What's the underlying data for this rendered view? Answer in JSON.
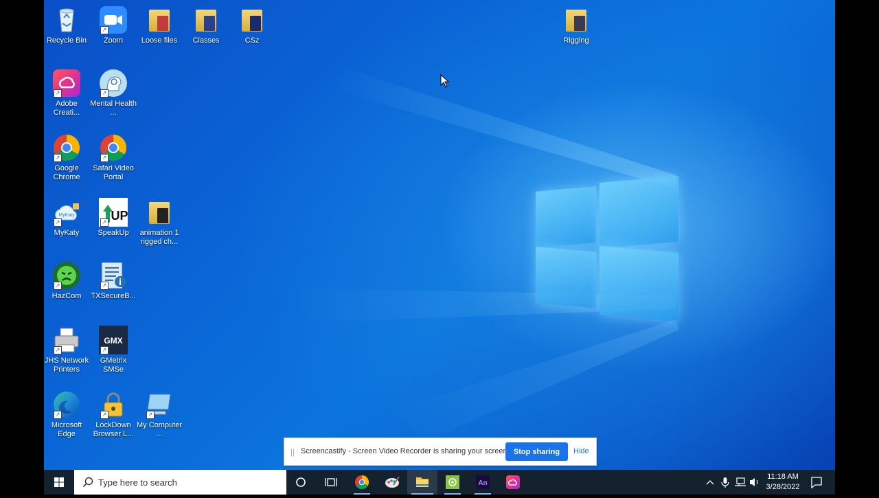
{
  "desktop": {
    "icons": [
      {
        "label": "Recycle Bin"
      },
      {
        "label": "Zoom"
      },
      {
        "label": "Loose files"
      },
      {
        "label": "Classes"
      },
      {
        "label": "CSz"
      },
      {
        "label": "Rigging"
      },
      {
        "label": "Adobe Creati..."
      },
      {
        "label": "Mental Health ..."
      },
      {
        "label": "Google Chrome"
      },
      {
        "label": "Safari Video Portal"
      },
      {
        "label": "MyKaty"
      },
      {
        "label": "SpeakUp"
      },
      {
        "label": "animation 1 rigged ch..."
      },
      {
        "label": "HazCom"
      },
      {
        "label": "TXSecureB..."
      },
      {
        "label": "JHS Network Printers"
      },
      {
        "label": "GMetrix SMSe"
      },
      {
        "label": "Microsoft Edge"
      },
      {
        "label": "LockDown Browser L..."
      },
      {
        "label": "My Computer ..."
      }
    ],
    "icon_text": {
      "gmx": "GMX",
      "speakup": "UP",
      "mykaty": "MyKaty"
    }
  },
  "share_bar": {
    "message": "Screencastify - Screen Video Recorder is sharing your screen.",
    "stop_label": "Stop sharing",
    "hide_label": "Hide"
  },
  "taskbar": {
    "search_placeholder": "Type here to search",
    "time": "11:18 AM",
    "date": "3/28/2022",
    "apps": [
      {
        "icon": "cortana-icon"
      },
      {
        "icon": "task-view-icon"
      },
      {
        "icon": "chrome-icon"
      },
      {
        "icon": "paint-icon"
      },
      {
        "icon": "file-explorer-icon"
      },
      {
        "icon": "app-icon"
      },
      {
        "icon": "animate-icon",
        "label": "An"
      },
      {
        "icon": "creative-cloud-icon"
      }
    ]
  },
  "colors": {
    "accent": "#1a73e8",
    "taskbar": "#14212e",
    "desktop": "#0a66d6"
  }
}
